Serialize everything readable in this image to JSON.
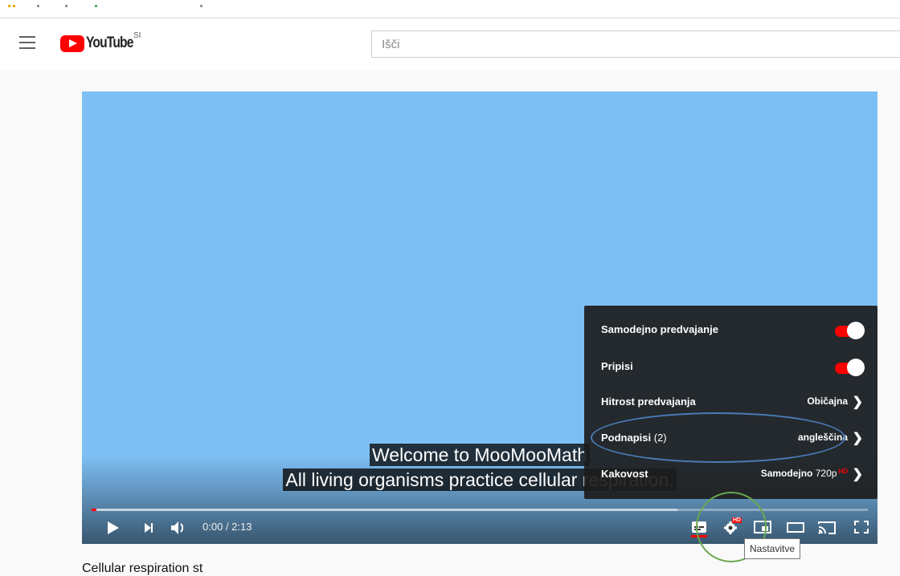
{
  "header": {
    "logo_text": "YouTube",
    "country_code": "SI",
    "search_placeholder": "Išči"
  },
  "captions": {
    "line1": "Welcome to MooMooMath",
    "line2": "All living organisms practice cellular respiration."
  },
  "player": {
    "time_display": "0:00 / 2:13",
    "progress_fraction": 0.005,
    "buffered_fraction": 0.755
  },
  "settings": {
    "autoplay_label": "Samodejno predvajanje",
    "autoplay_on": true,
    "annotations_label": "Pripisi",
    "annotations_on": true,
    "speed_label": "Hitrost predvajanja",
    "speed_value": "Običajna",
    "subtitles_label": "Podnapisi",
    "subtitles_count": "(2)",
    "subtitles_value": "angleščina",
    "quality_label": "Kakovost",
    "quality_value": "Samodejno",
    "quality_res": "720p",
    "quality_badge": "HD",
    "gear_badge": "HD"
  },
  "tooltip": "Nastavitve",
  "accent_colors": {
    "red": "#ff0000",
    "annotation_oval": "#4a7bb7",
    "annotation_circle": "#6aa84f"
  },
  "icons": [
    "menu-icon",
    "youtube-logo-icon",
    "play-icon",
    "next-icon",
    "volume-icon",
    "captions-icon",
    "settings-gear-icon",
    "miniplayer-icon",
    "theater-icon",
    "cast-icon",
    "fullscreen-icon",
    "chevron-right-icon"
  ],
  "below_text": "Cellular respiration st"
}
